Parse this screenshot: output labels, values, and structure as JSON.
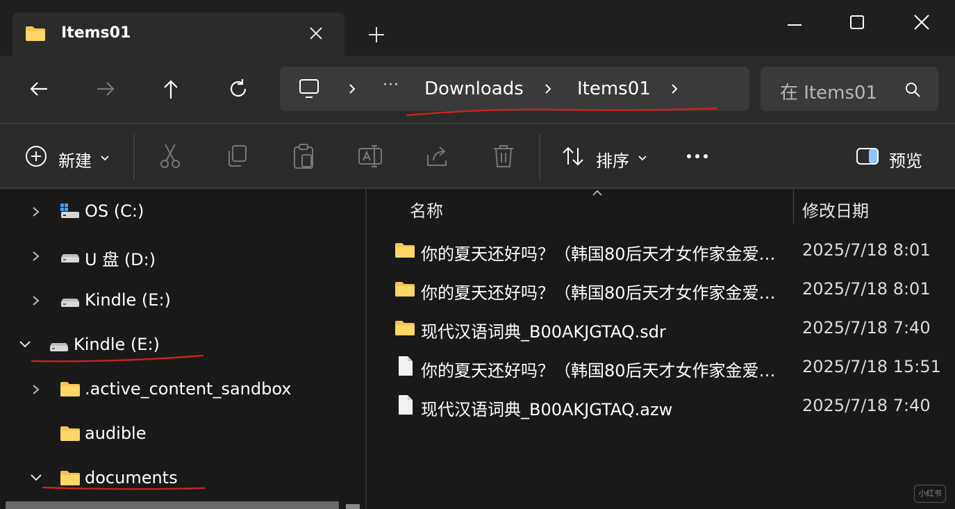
{
  "window": {
    "tab_title": "Items01",
    "colors": {
      "titlebar": "#1f1f1f",
      "toolbar": "#2b2b2b",
      "pane": "#191919",
      "folder": "#f5c451",
      "annotation": "#c8231c"
    }
  },
  "address": {
    "overflow": "···",
    "crumbs": [
      "Downloads",
      "Items01"
    ]
  },
  "search": {
    "placeholder": "在 Items01"
  },
  "commands": {
    "new_label": "新建",
    "sort_label": "排序",
    "preview_label": "预览"
  },
  "navtree": [
    {
      "label": "OS (C:)",
      "icon": "windows-drive-icon",
      "expanded": false
    },
    {
      "label": "U 盘 (D:)",
      "icon": "drive-icon",
      "expanded": false
    },
    {
      "label": "Kindle (E:)",
      "icon": "drive-icon",
      "expanded": false
    },
    {
      "label": "Kindle (E:)",
      "icon": "drive-icon",
      "expanded": true
    },
    {
      "label": ".active_content_sandbox",
      "icon": "folder-icon",
      "expanded": false
    },
    {
      "label": "audible",
      "icon": "folder-icon",
      "expanded": false
    },
    {
      "label": "documents",
      "icon": "folder-icon",
      "expanded": true
    }
  ],
  "columns": {
    "name": "名称",
    "modified": "修改日期"
  },
  "files": [
    {
      "name": "你的夏天还好吗？（韩国80后天才女作家金爱…",
      "modified": "2025/7/18 8:01",
      "type": "folder"
    },
    {
      "name": "你的夏天还好吗？（韩国80后天才女作家金爱…",
      "modified": "2025/7/18 8:01",
      "type": "folder"
    },
    {
      "name": "现代汉语词典_B00AKJGTAQ.sdr",
      "modified": "2025/7/18 7:40",
      "type": "folder"
    },
    {
      "name": "你的夏天还好吗？（韩国80后天才女作家金爱…",
      "modified": "2025/7/18 15:51",
      "type": "file"
    },
    {
      "name": "现代汉语词典_B00AKJGTAQ.azw",
      "modified": "2025/7/18 7:40",
      "type": "file"
    }
  ],
  "watermark": "小红书"
}
